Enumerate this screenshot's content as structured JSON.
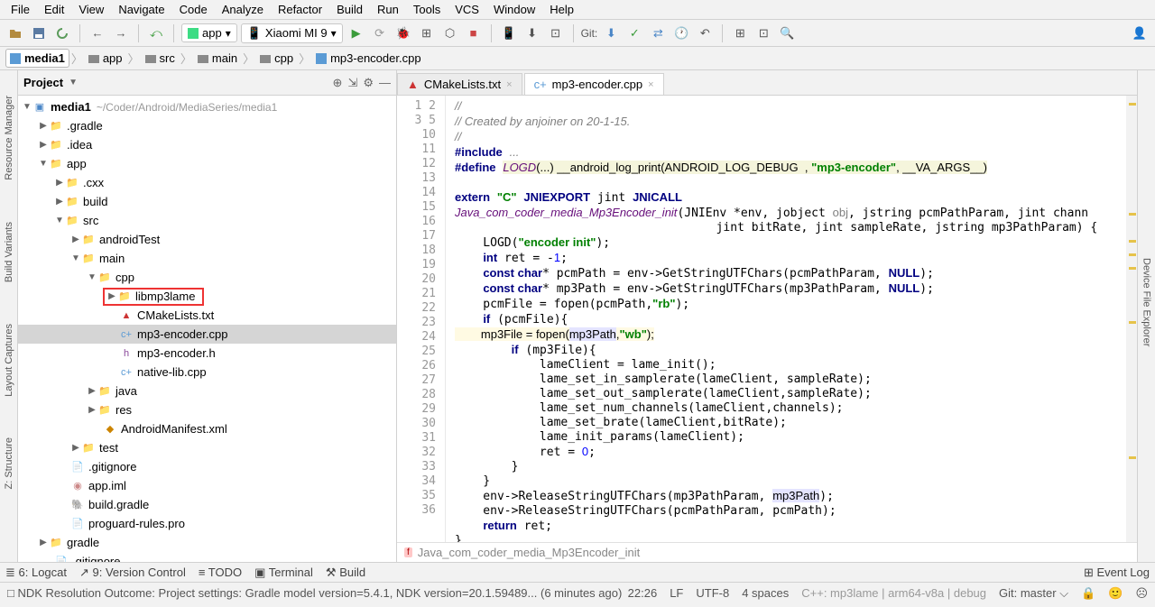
{
  "menu": [
    "File",
    "Edit",
    "View",
    "Navigate",
    "Code",
    "Analyze",
    "Refactor",
    "Build",
    "Run",
    "Tools",
    "VCS",
    "Window",
    "Help"
  ],
  "toolbar": {
    "run_combo1": "app",
    "run_combo2": "Xiaomi MI 9",
    "git_label": "Git:"
  },
  "breadcrumb": [
    {
      "label": "media1"
    },
    {
      "label": "app"
    },
    {
      "label": "src"
    },
    {
      "label": "main"
    },
    {
      "label": "cpp"
    },
    {
      "label": "mp3-encoder.cpp"
    }
  ],
  "panel": {
    "title": "Project"
  },
  "tree": {
    "root": {
      "label": "media1",
      "hint": "~/Coder/Android/MediaSeries/media1"
    },
    "gradle": ".gradle",
    "idea": ".idea",
    "app": "app",
    "cxx": ".cxx",
    "build": "build",
    "src": "src",
    "androidTest": "androidTest",
    "main": "main",
    "cpp": "cpp",
    "libmp3lame": "libmp3lame",
    "cmakelists": "CMakeLists.txt",
    "mp3enc_cpp": "mp3-encoder.cpp",
    "mp3enc_h": "mp3-encoder.h",
    "nativelib": "native-lib.cpp",
    "java": "java",
    "res": "res",
    "manifest": "AndroidManifest.xml",
    "test": "test",
    "gitignore": ".gitignore",
    "appiml": "app.iml",
    "buildgradle": "build.gradle",
    "proguard": "proguard-rules.pro",
    "gradle2": "gradle",
    "gitignore2": ".gitignore"
  },
  "tabs": [
    {
      "label": "CMakeLists.txt",
      "active": false
    },
    {
      "label": "mp3-encoder.cpp",
      "active": true
    }
  ],
  "code_lines": [
    1,
    2,
    3,
    5,
    10,
    11,
    12,
    13,
    14,
    15,
    16,
    17,
    18,
    19,
    20,
    21,
    22,
    23,
    24,
    25,
    26,
    27,
    28,
    29,
    30,
    31,
    32,
    33,
    34,
    35,
    36
  ],
  "crumb": "Java_com_coder_media_Mp3Encoder_init",
  "left_tabs": [
    "Resource Manager",
    "Build Variants",
    "Layout Captures",
    "Z: Structure"
  ],
  "right_tabs": [
    "Device File Explorer"
  ],
  "bottom": {
    "left": [
      "≣ 6: Logcat",
      "↗ 9: Version Control",
      "≡ TODO",
      "▣ Terminal",
      "⚒ Build"
    ],
    "right": [
      "⊞ Event Log"
    ]
  },
  "status": {
    "msg": "NDK Resolution Outcome: Project settings: Gradle model version=5.4.1, NDK version=20.1.59489... (6 minutes ago)",
    "pos": "22:26",
    "lf": "LF",
    "enc": "UTF-8",
    "indent": "4 spaces",
    "ctx": "C++: mp3lame | arm64-v8a | debug",
    "git": "Git: master"
  }
}
